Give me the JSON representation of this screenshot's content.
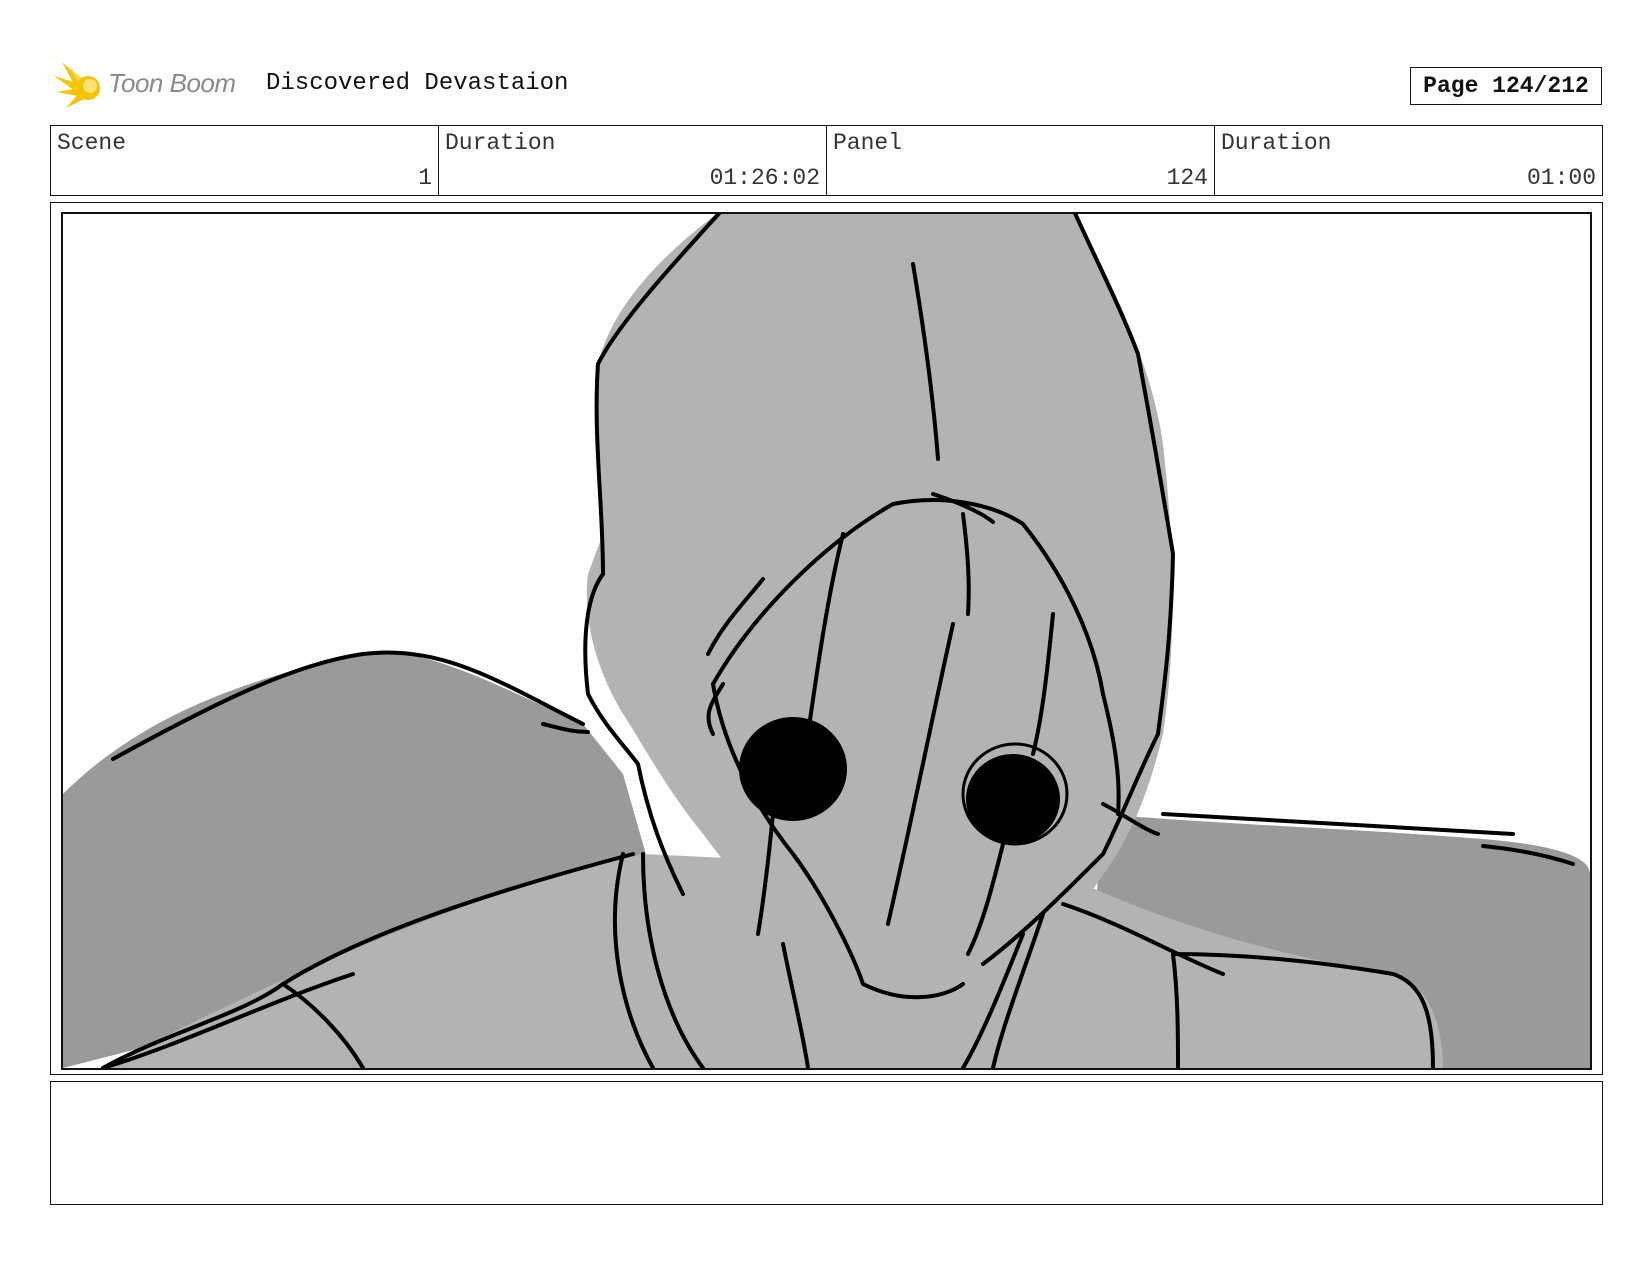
{
  "header": {
    "logo_text": "Toon Boom",
    "document_title": "Discovered Devastaion",
    "page_label": "Page 124/212"
  },
  "info": [
    {
      "label": "Scene",
      "value": "1"
    },
    {
      "label": "Duration",
      "value": "01:26:02"
    },
    {
      "label": "Panel",
      "value": "124"
    },
    {
      "label": "Duration",
      "value": "01:00"
    }
  ],
  "notes": "",
  "colors": {
    "logo_accent": "#f5c400",
    "sketch_light_gray": "#b3b3b3",
    "sketch_dark_gray": "#9a9a9a",
    "ink": "#000000"
  }
}
